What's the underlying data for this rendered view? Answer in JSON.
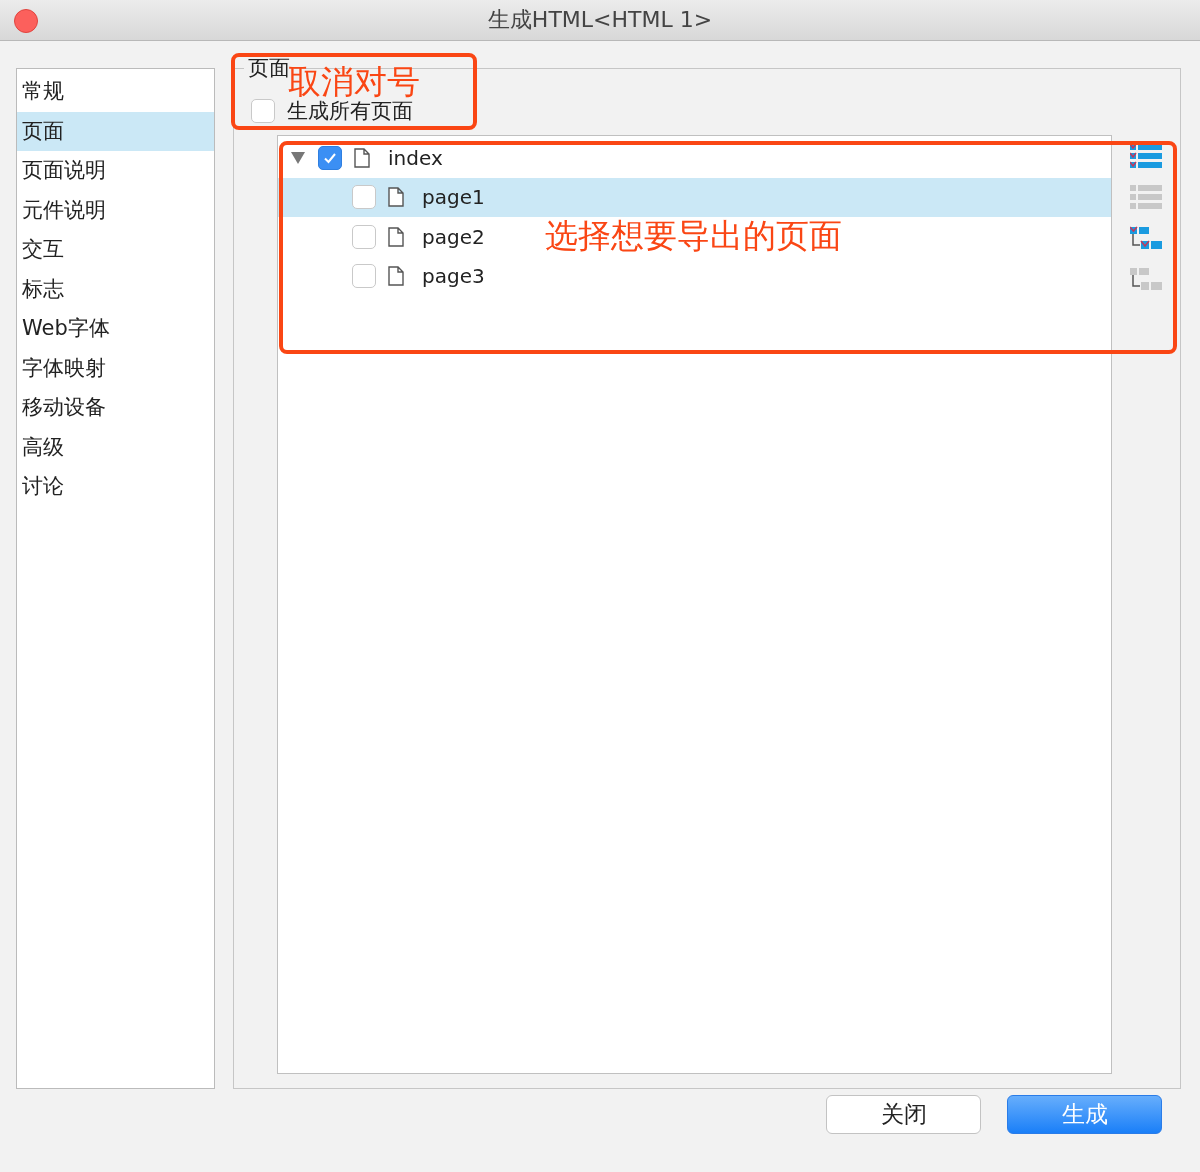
{
  "window": {
    "title": "生成HTML<HTML 1>"
  },
  "sidebar": {
    "items": [
      {
        "label": "常规",
        "selected": false
      },
      {
        "label": "页面",
        "selected": true
      },
      {
        "label": "页面说明",
        "selected": false
      },
      {
        "label": "元件说明",
        "selected": false
      },
      {
        "label": "交互",
        "selected": false
      },
      {
        "label": "标志",
        "selected": false
      },
      {
        "label": "Web字体",
        "selected": false
      },
      {
        "label": "字体映射",
        "selected": false
      },
      {
        "label": "移动设备",
        "selected": false
      },
      {
        "label": "高级",
        "selected": false
      },
      {
        "label": "讨论",
        "selected": false
      }
    ]
  },
  "group": {
    "title": "页面",
    "generate_all": {
      "label": "生成所有页面",
      "checked": false
    }
  },
  "tree": [
    {
      "label": "index",
      "checked": true,
      "selected": false,
      "expanded": true,
      "children": [
        {
          "label": "page1",
          "checked": false,
          "selected": true
        },
        {
          "label": "page2",
          "checked": false,
          "selected": false
        },
        {
          "label": "page3",
          "checked": false,
          "selected": false
        }
      ]
    }
  ],
  "toolbar": [
    {
      "kind": "check-all"
    },
    {
      "kind": "uncheck-all"
    },
    {
      "kind": "check-children"
    },
    {
      "kind": "uncheck-children"
    }
  ],
  "buttons": [
    {
      "label": "关闭",
      "kind": "secondary"
    },
    {
      "label": "生成",
      "kind": "primary"
    }
  ],
  "annotations": [
    {
      "text": "取消对号"
    },
    {
      "text": "选择想要导出的页面"
    }
  ]
}
